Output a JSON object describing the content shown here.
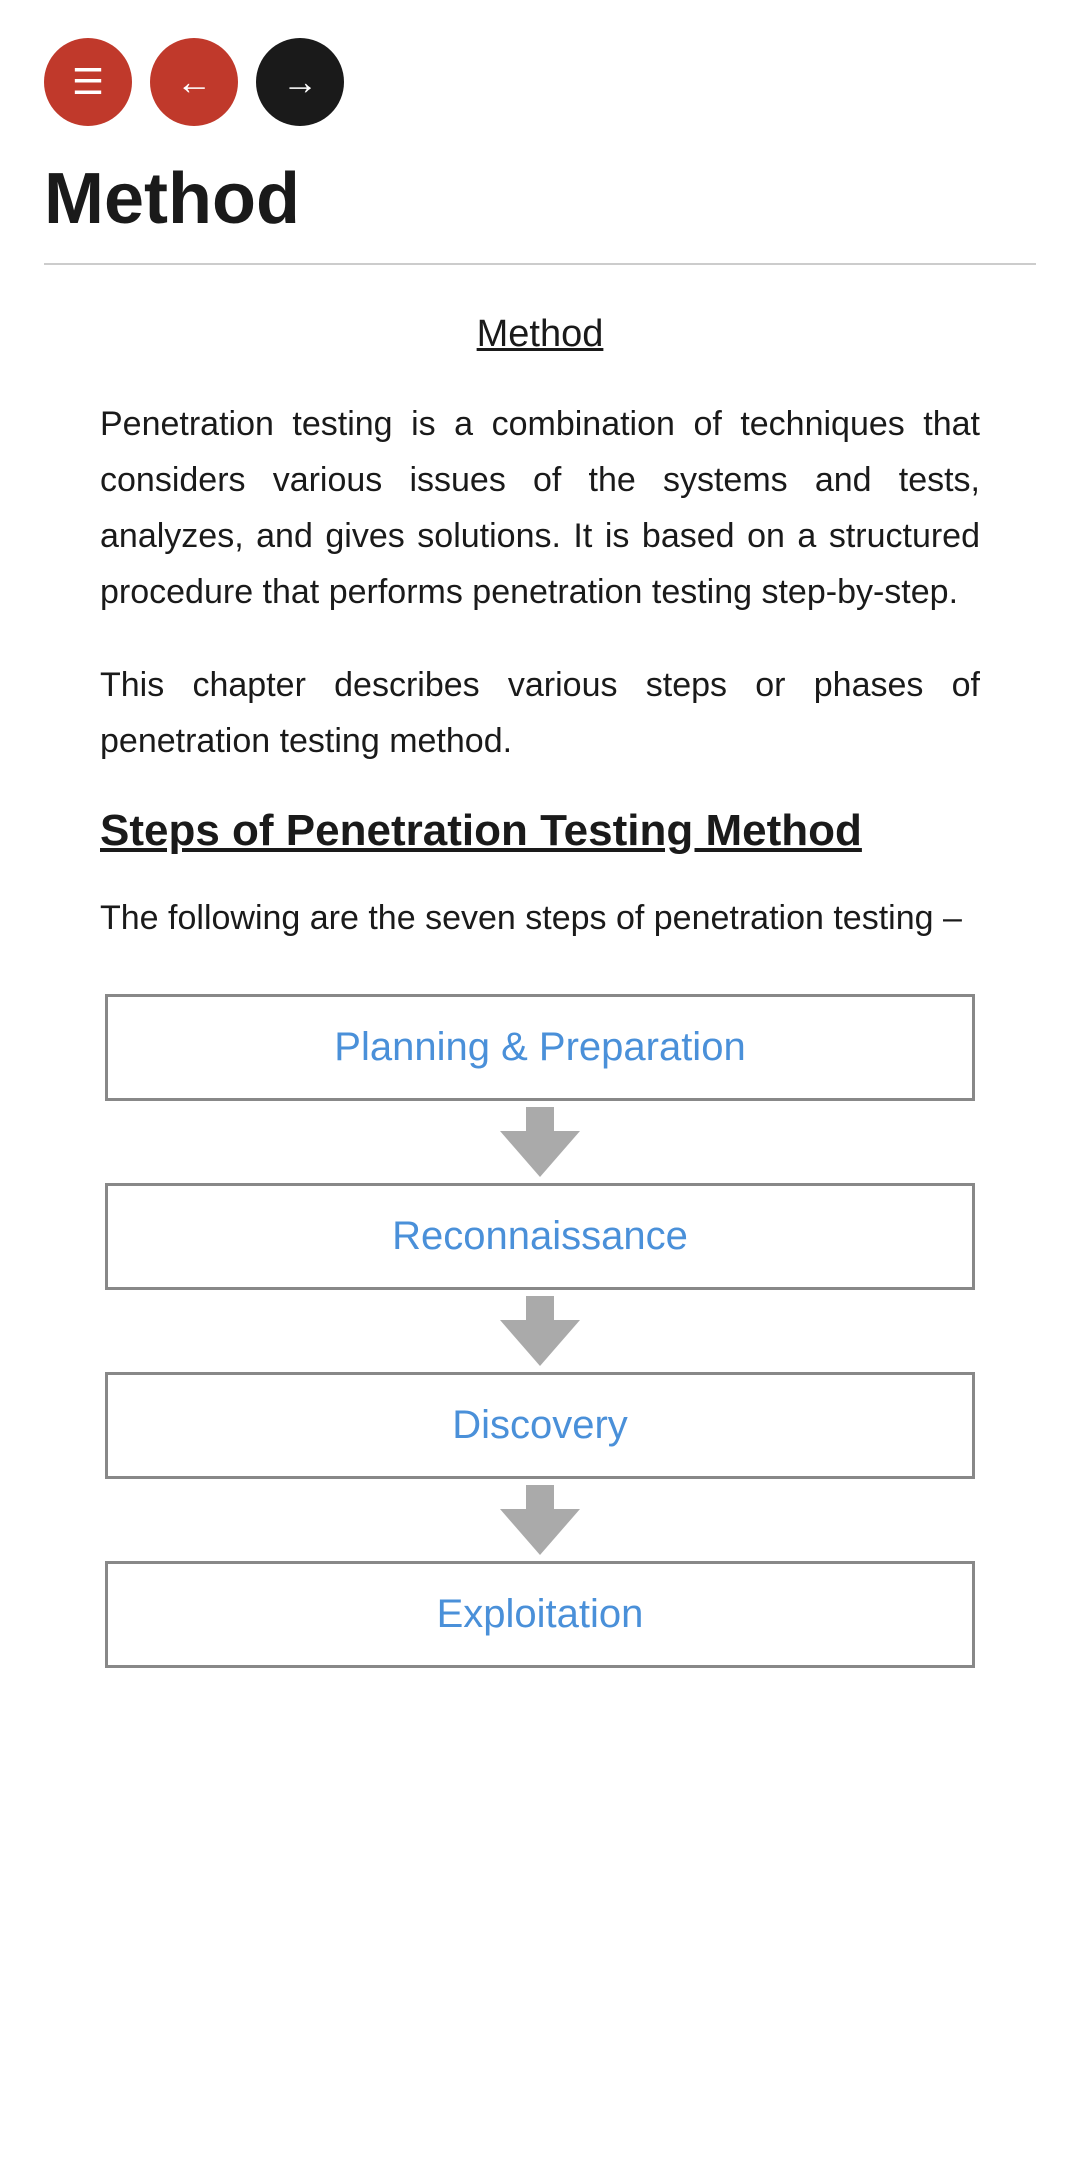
{
  "nav": {
    "menu_label": "☰",
    "back_label": "←",
    "forward_label": "→"
  },
  "page": {
    "title": "Method"
  },
  "content": {
    "section_link": "Method",
    "paragraph1": "Penetration testing is a combination of techniques that considers various issues of the systems and tests, analyzes, and gives solutions. It is based on a structured procedure that performs penetration testing step-by-step.",
    "paragraph2": "This chapter describes various steps or phases of penetration testing method.",
    "steps_heading": "Steps of Penetration Testing Method",
    "steps_intro": "The following are the seven steps of penetration testing –",
    "steps": [
      {
        "label": "Planning & Preparation"
      },
      {
        "label": "Reconnaissance"
      },
      {
        "label": "Discovery"
      },
      {
        "label": "Exploitation"
      }
    ]
  }
}
